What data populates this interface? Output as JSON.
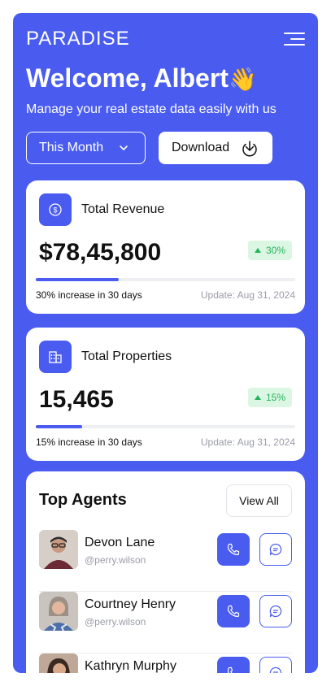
{
  "app": {
    "logo": "PARADISE"
  },
  "hero": {
    "greeting": "Welcome, Albert",
    "wave_emoji": "👋",
    "subtitle": "Manage your real estate data easily with us"
  },
  "controls": {
    "period_label": "This Month",
    "download_label": "Download"
  },
  "stats": [
    {
      "title": "Total Revenue",
      "icon": "dollar-coin-icon",
      "value": "$78,45,800",
      "change": "30%",
      "progress": 0.32,
      "note": "30% increase in 30 days",
      "update": "Update: Aug 31, 2024"
    },
    {
      "title": "Total Properties",
      "icon": "building-icon",
      "value": "15,465",
      "change": "15%",
      "progress": 0.18,
      "note": "15% increase in 30 days",
      "update": "Update: Aug 31, 2024"
    }
  ],
  "agents": {
    "title": "Top Agents",
    "view_all_label": "View All",
    "list": [
      {
        "name": "Devon Lane",
        "handle": "@perry.wilson"
      },
      {
        "name": "Courtney Henry",
        "handle": "@perry.wilson"
      },
      {
        "name": "Kathryn Murphy",
        "handle": ""
      }
    ]
  },
  "colors": {
    "brand": "#4a5cf0",
    "success": "#22b45a",
    "success_bg": "#dcf6e4"
  }
}
